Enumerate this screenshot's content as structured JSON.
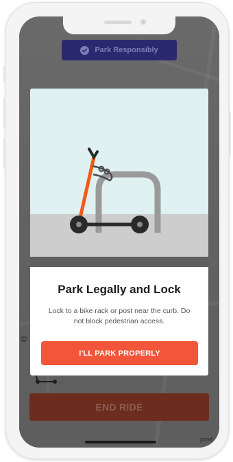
{
  "banner": {
    "label": "Park Responsibly",
    "icon": "check-circle-icon"
  },
  "modal": {
    "title": "Park Legally and Lock",
    "body": "Lock to a bike rack or post near the curb.  Do not block pedestrian access.",
    "button_label": "I'LL PARK PROPERLY",
    "illustration": "scooter-locked-to-bike-rack"
  },
  "end_ride": {
    "label": "END RIDE"
  },
  "footer": {
    "env_label": "prod"
  },
  "colors": {
    "accent": "#f2553a",
    "banner_bg": "#2a2970",
    "end_ride_bg": "#6c2d1f",
    "scooter": "#f25a1a"
  }
}
